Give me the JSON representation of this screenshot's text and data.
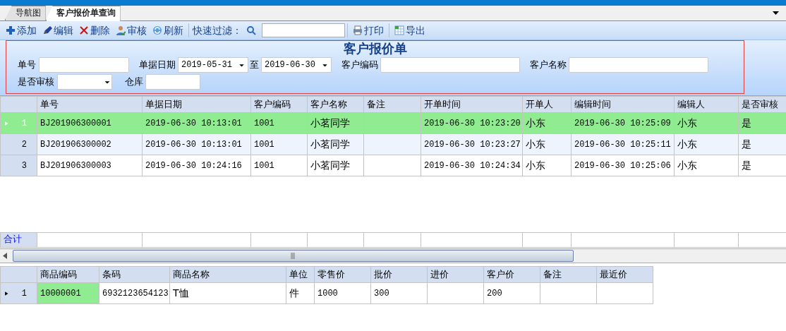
{
  "tabs": [
    {
      "label": "导航图",
      "selected": false
    },
    {
      "label": "客户报价单查询",
      "selected": true
    }
  ],
  "toolbar": [
    {
      "kind": "button",
      "label": "添加"
    },
    {
      "kind": "button",
      "label": "编辑"
    },
    {
      "kind": "button",
      "label": "删除"
    },
    {
      "kind": "button",
      "label": "审核"
    },
    {
      "kind": "button",
      "label": "刷新"
    },
    {
      "kind": "separator"
    },
    {
      "kind": "label",
      "label": "快速过滤："
    },
    {
      "kind": "search"
    },
    {
      "kind": "separator"
    },
    {
      "kind": "button",
      "label": "打印"
    },
    {
      "kind": "separator"
    },
    {
      "kind": "button",
      "label": "导出"
    }
  ],
  "filter": {
    "title": "客户报价单",
    "rows": [
      [
        {
          "kind": "text",
          "label": "单号"
        },
        {
          "kind": "date",
          "label": "单据日期",
          "value": "2019-05-31"
        },
        {
          "kind": "date",
          "label": "至",
          "value": "2019-06-30"
        },
        {
          "kind": "text",
          "label": "客户编码"
        },
        {
          "kind": "text",
          "label": "客户名称"
        }
      ],
      [
        {
          "kind": "select",
          "label": "是否审核"
        },
        {
          "kind": "text",
          "label": "仓库"
        }
      ]
    ]
  },
  "main_grid": {
    "columns": [
      "单号",
      "单据日期",
      "客户编码",
      "客户名称",
      "备注",
      "开单时间",
      "开单人",
      "编辑时间",
      "编辑人",
      "是否审核"
    ],
    "rows": [
      {
        "number": "1",
        "selected": true,
        "cells": [
          "BJ201906300001",
          "2019-06-30 10:13:01",
          "1001",
          "小茗同学",
          "",
          "2019-06-30 10:23:20",
          "小东",
          "2019-06-30 10:25:09",
          "小东",
          "是"
        ]
      },
      {
        "number": "2",
        "selected": false,
        "cells": [
          "BJ201906300002",
          "2019-06-30 10:13:01",
          "1001",
          "小茗同学",
          "",
          "2019-06-30 10:23:27",
          "小东",
          "2019-06-30 10:25:11",
          "小东",
          "是"
        ]
      },
      {
        "number": "3",
        "selected": false,
        "cells": [
          "BJ201906300003",
          "2019-06-30 10:24:16",
          "1001",
          "小茗同学",
          "",
          "2019-06-30 10:24:34",
          "小东",
          "2019-06-30 10:25:06",
          "小东",
          "是"
        ]
      }
    ],
    "footer_label": "合计"
  },
  "detail_grid": {
    "columns": [
      "商品编码",
      "条码",
      "商品名称",
      "单位",
      "零售价",
      "批价",
      "进价",
      "客户价",
      "备注",
      "最近价"
    ],
    "rows": [
      {
        "number": "1",
        "selected": true,
        "cells": [
          "10000001",
          "6932123654123",
          "T恤",
          "件",
          "1000",
          "300",
          "",
          "200",
          "",
          ""
        ]
      }
    ]
  }
}
